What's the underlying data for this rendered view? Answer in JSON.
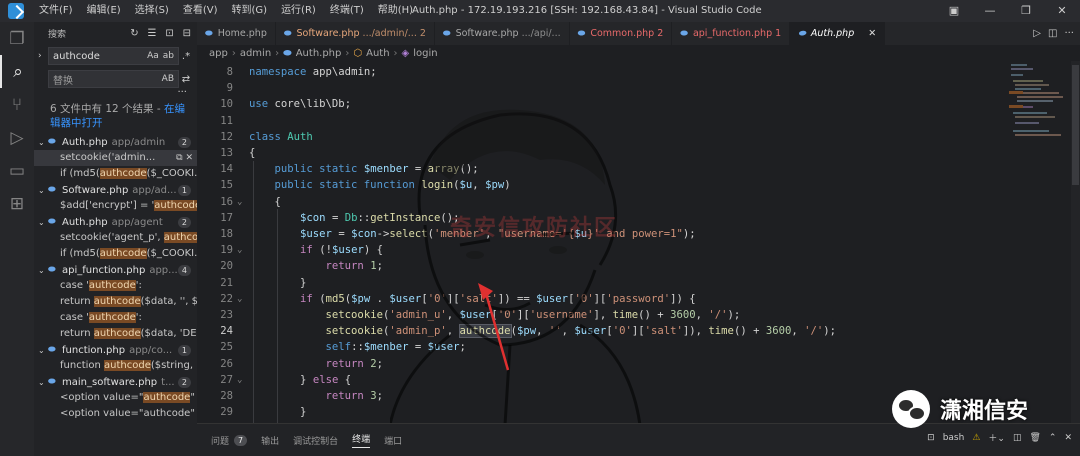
{
  "window": {
    "title": "Auth.php - 172.19.193.216 [SSH: 192.168.43.84] - Visual Studio Code",
    "menu": [
      "文件(F)",
      "编辑(E)",
      "选择(S)",
      "查看(V)",
      "转到(G)",
      "运行(R)",
      "终端(T)",
      "帮助(H)"
    ]
  },
  "sidebar": {
    "title": "搜索",
    "search_value": "authcode",
    "search_opts": [
      "Aa",
      "ab",
      ".*"
    ],
    "replace_placeholder": "替换",
    "replace_opt": "AB",
    "summary_text": "6 文件中有 12 个结果 - ",
    "summary_link": "在编辑器中打开",
    "files": [
      {
        "name": "Auth.php",
        "path": "app/admin",
        "count": "2",
        "matches": [
          {
            "pre": "setcookie('admin...",
            "hl": "",
            "post": ""
          },
          {
            "pre": "if (md5(",
            "hl": "authcode",
            "post": "($_COOKI..."
          }
        ]
      },
      {
        "name": "Software.php",
        "path": "app/ad...",
        "count": "1",
        "matches": [
          {
            "pre": "$add['encrypt'] = '",
            "hl": "authcode",
            "post": "';"
          }
        ]
      },
      {
        "name": "Auth.php",
        "path": "app/agent",
        "count": "2",
        "matches": [
          {
            "pre": "setcookie('agent_p', ",
            "hl": "authco",
            "post": ""
          },
          {
            "pre": "if (md5(",
            "hl": "authcode",
            "post": "($_COOKI..."
          }
        ]
      },
      {
        "name": "api_function.php",
        "path": "app...",
        "count": "4",
        "matches": [
          {
            "pre": "case '",
            "hl": "authcode",
            "post": "':"
          },
          {
            "pre": "return ",
            "hl": "authcode",
            "post": "($data, '', $..."
          },
          {
            "pre": "case '",
            "hl": "authcode",
            "post": "':"
          },
          {
            "pre": "return ",
            "hl": "authcode",
            "post": "($data, 'DE..."
          }
        ]
      },
      {
        "name": "function.php",
        "path": "app/co...",
        "count": "1",
        "matches": [
          {
            "pre": "function ",
            "hl": "authcode",
            "post": "($string, ..."
          }
        ]
      },
      {
        "name": "main_software.php",
        "path": "t...",
        "count": "2",
        "matches": [
          {
            "pre": "<option value=\"",
            "hl": "authcode",
            "post": "\" ..."
          },
          {
            "pre": "<option value=\"authcode\" ...",
            "hl": "",
            "post": ""
          }
        ]
      }
    ]
  },
  "tabs": [
    {
      "label": "Home.php",
      "suffix": "",
      "state": "normal"
    },
    {
      "label": "Software.php",
      "suffix": ".../admin/... 2",
      "state": "mod"
    },
    {
      "label": "Software.php",
      "suffix": ".../api/...",
      "state": "normal"
    },
    {
      "label": "Common.php 2",
      "suffix": "",
      "state": "mod2"
    },
    {
      "label": "api_function.php 1",
      "suffix": "",
      "state": "mod2"
    },
    {
      "label": "Auth.php",
      "suffix": "",
      "state": "active"
    }
  ],
  "breadcrumbs": [
    "app",
    "admin",
    "Auth.php",
    "Auth",
    "login"
  ],
  "code": [
    {
      "n": "8",
      "h": "<span class='k'>namespace</span> <span class='p'>app\\admin;</span>"
    },
    {
      "n": "9",
      "h": ""
    },
    {
      "n": "10",
      "h": "<span class='k'>use</span> <span class='p'>core\\lib\\Db;</span>"
    },
    {
      "n": "11",
      "h": ""
    },
    {
      "n": "12",
      "h": "<span class='k'>class</span> <span class='cl'>Auth</span>"
    },
    {
      "n": "13",
      "h": "<span class='p'>{</span>"
    },
    {
      "n": "14",
      "h": "    <span class='k'>public static</span> <span class='v'>$menber</span> <span class='p'>=</span> <span class='fn'>array</span><span class='p'>();</span>"
    },
    {
      "n": "15",
      "h": "    <span class='k'>public static function</span> <span class='fn'>login</span><span class='p'>(</span><span class='v'>$u</span><span class='p'>,</span> <span class='v'>$pw</span><span class='p'>)</span>"
    },
    {
      "n": "16",
      "h": "    <span class='p'>{</span>"
    },
    {
      "n": "17",
      "h": "        <span class='v'>$con</span> <span class='p'>=</span> <span class='cl'>Db</span><span class='p'>::</span><span class='fn'>getInstance</span><span class='p'>();</span>"
    },
    {
      "n": "18",
      "h": "        <span class='v'>$user</span> <span class='p'>=</span> <span class='v'>$con</span><span class='p'>-></span><span class='fn'>select</span><span class='p'>(</span><span class='s'>'menber'</span><span class='p'>,</span> <span class='s'>\"username='{</span><span class='v'>$u</span><span class='s'>}' and power=1\"</span><span class='p'>);</span>"
    },
    {
      "n": "19",
      "h": "        <span class='kf'>if</span> <span class='p'>(!</span><span class='v'>$user</span><span class='p'>) {</span>"
    },
    {
      "n": "20",
      "h": "            <span class='kf'>return</span> <span class='n'>1</span><span class='p'>;</span>"
    },
    {
      "n": "21",
      "h": "        <span class='p'>}</span>"
    },
    {
      "n": "22",
      "h": "        <span class='kf'>if</span> <span class='p'>(</span><span class='fn'>md5</span><span class='p'>(</span><span class='v'>$pw</span> <span class='p'>.</span> <span class='v'>$user</span><span class='p'>[</span><span class='s'>'0'</span><span class='p'>][</span><span class='s'>'salt'</span><span class='p'>]) ==</span> <span class='v'>$user</span><span class='p'>[</span><span class='s'>'0'</span><span class='p'>][</span><span class='s'>'password'</span><span class='p'>]) {</span>"
    },
    {
      "n": "23",
      "h": "            <span class='fn'>setcookie</span><span class='p'>(</span><span class='s'>'admin_u'</span><span class='p'>,</span> <span class='v'>$user</span><span class='p'>[</span><span class='s'>'0'</span><span class='p'>][</span><span class='s'>'username'</span><span class='p'>],</span> <span class='fn'>time</span><span class='p'>() +</span> <span class='n'>3600</span><span class='p'>,</span> <span class='s'>'/'</span><span class='p'>);</span>"
    },
    {
      "n": "24",
      "h": "            <span class='fn'>setcookie</span><span class='p'>(</span><span class='s'>'admin_p'</span><span class='p'>,</span> <span class='fn hlw'>authcode</span><span class='p'>(</span><span class='v'>$pw</span><span class='p'>,</span> <span class='s'>''</span><span class='p'>,</span> <span class='v'>$user</span><span class='p'>[</span><span class='s'>'0'</span><span class='p'>][</span><span class='s'>'salt'</span><span class='p'>]),</span> <span class='fn'>time</span><span class='p'>() +</span> <span class='n'>3600</span><span class='p'>,</span> <span class='s'>'/'</span><span class='p'>);</span>"
    },
    {
      "n": "25",
      "h": "            <span class='k'>self</span><span class='p'>::</span><span class='v'>$menber</span> <span class='p'>=</span> <span class='v'>$user</span><span class='p'>;</span>"
    },
    {
      "n": "26",
      "h": "            <span class='kf'>return</span> <span class='n'>2</span><span class='p'>;</span>"
    },
    {
      "n": "27",
      "h": "        <span class='p'>}</span> <span class='kf'>else</span> <span class='p'>{</span>"
    },
    {
      "n": "28",
      "h": "            <span class='kf'>return</span> <span class='n'>3</span><span class='p'>;</span>"
    },
    {
      "n": "29",
      "h": "        <span class='p'>}</span>"
    }
  ],
  "current_line": "24",
  "watermark_text": "奇安信攻防社区",
  "panel": {
    "tabs": [
      {
        "label": "问题",
        "badge": "7",
        "active": false
      },
      {
        "label": "输出",
        "badge": "",
        "active": false
      },
      {
        "label": "调试控制台",
        "badge": "",
        "active": false
      },
      {
        "label": "终端",
        "badge": "",
        "active": true
      },
      {
        "label": "端口",
        "badge": "",
        "active": false
      }
    ],
    "terminal_name": "bash"
  },
  "brand": {
    "name": "潇湘信安"
  }
}
